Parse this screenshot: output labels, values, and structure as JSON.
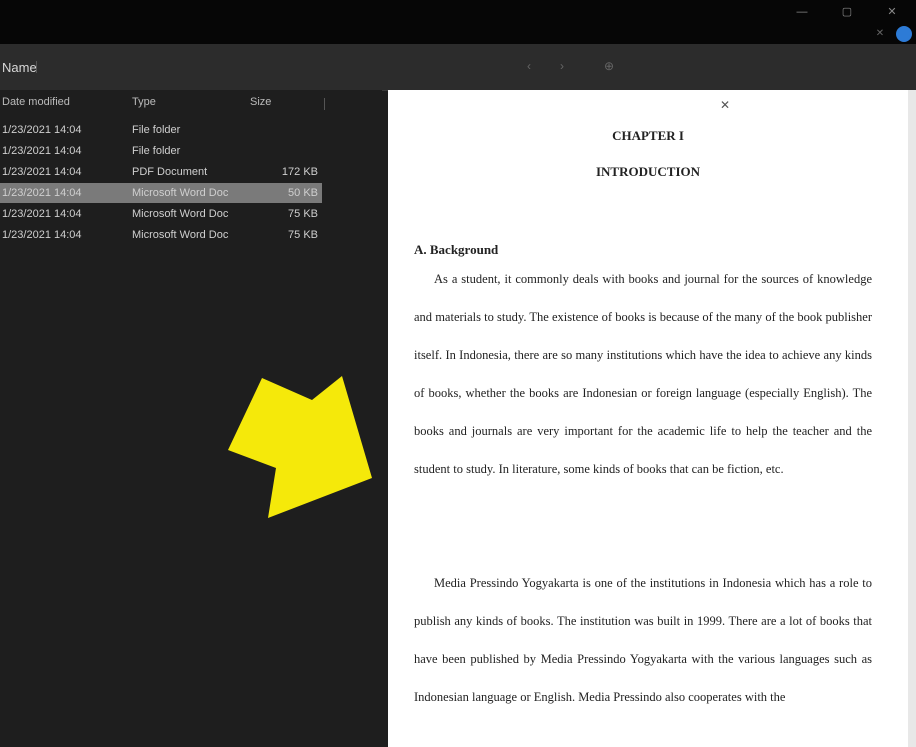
{
  "window": {
    "minimize_icon": "minimize-icon",
    "maximize_icon": "maximize-icon",
    "close_icon": "close-icon",
    "min_glyph": "—",
    "max_glyph": "▢",
    "close_glyph": "✕"
  },
  "toolbar": {
    "breadcrumb": "Name",
    "zoom_label": "",
    "back_glyph": "‹",
    "forward_glyph": "›",
    "zoom_glyph": "⊕"
  },
  "filelist": {
    "columns": [
      "Date modified",
      "Type",
      "Size"
    ],
    "rows": [
      {
        "name": "1/23/2021 14:04",
        "type": "File folder",
        "size": "",
        "selected": false
      },
      {
        "name": "1/23/2021 14:04",
        "type": "File folder",
        "size": "",
        "selected": false
      },
      {
        "name": "1/23/2021 14:04",
        "type": "PDF Document",
        "size": "172 KB",
        "selected": false
      },
      {
        "name": "1/23/2021 14:04",
        "type": "Microsoft Word Doc",
        "size": "50 KB",
        "selected": true
      },
      {
        "name": "1/23/2021 14:04",
        "type": "Microsoft Word Doc",
        "size": "75 KB",
        "selected": false
      },
      {
        "name": "1/23/2021 14:04",
        "type": "Microsoft Word Doc",
        "size": "75 KB",
        "selected": false
      }
    ]
  },
  "preview": {
    "close_glyph": "✕",
    "chapter": "CHAPTER I",
    "title": "INTRODUCTION",
    "heading": "A. Background",
    "paragraph1": "As a student, it commonly deals with books and journal for the sources of knowledge and materials to study. The existence of books is because of the many of the book publisher itself. In Indonesia, there are so many institutions which have the idea to achieve any kinds of books, whether the books are Indonesian or foreign language (especially English). The books and journals are very important for the academic life to help the teacher and the student to study. In literature, some kinds of books that can be fiction, etc.",
    "paragraph2": "Media Pressindo Yogyakarta is one of the institutions in Indonesia which has a role to publish any kinds of books. The institution was built in 1999. There are a lot of books that have been published by Media Pressindo Yogyakarta with the various languages such as Indonesian language or English. Media Pressindo also cooperates with the"
  },
  "colors": {
    "titlebar": "#060606",
    "toolbar": "#2c2c2c",
    "pane": "#1e1e1e",
    "selected_row": "#7a7a7a",
    "arrow": "#f5e90a",
    "status_dot": "#2d7bd6"
  }
}
